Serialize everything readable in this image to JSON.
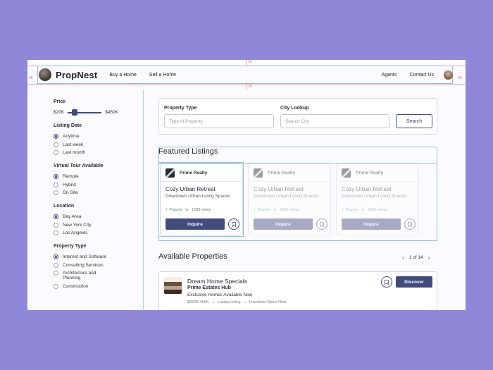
{
  "guides": {
    "top_gap": "16",
    "side_gap_left": "40",
    "side_gap_right": "40",
    "below_header_gap": "16"
  },
  "header": {
    "brand": "PropNest",
    "nav_left": [
      "Buy a Home",
      "Sell a Home"
    ],
    "nav_right": [
      "Agents",
      "Contact Us"
    ]
  },
  "filters": {
    "price": {
      "title": "Price",
      "min_label": "$20K",
      "max_label": "$450K",
      "level_fraction": 0.15
    },
    "listing_date": {
      "title": "Listing Date",
      "options": [
        "Anytime",
        "Last week",
        "Last month"
      ],
      "selected": 0
    },
    "virtual_tour": {
      "title": "Virtual Tour Available",
      "options": [
        "Remote",
        "Hybrid",
        "On Site"
      ],
      "selected": 0
    },
    "location": {
      "title": "Location",
      "options": [
        "Bay Area",
        "New York City",
        "Los Angeles"
      ],
      "selected": 0
    },
    "property_type": {
      "title": "Property Type",
      "options": [
        "Internet and Software",
        "Consulting Services",
        "Architecture and Planning",
        "Construction"
      ],
      "selected": 0
    }
  },
  "search": {
    "property_type_label": "Property Type",
    "property_type_placeholder": "Type of Property",
    "city_label": "City Lookup",
    "city_placeholder": "Search City",
    "button": "Search"
  },
  "featured": {
    "title": "Featured Listings",
    "cards": [
      {
        "company": "Prime Realty",
        "title": "Cozy Urban Retreat",
        "subtitle": "Downtown Urban Living Spaces",
        "badge": "Popular",
        "views": "1500 views",
        "button": "Inquire"
      },
      {
        "company": "Prime Realty",
        "title": "Cozy Urban Retreat",
        "subtitle": "Downtown Urban Living Spaces",
        "badge": "Popular",
        "views": "1500 views",
        "button": "Inquire"
      },
      {
        "company": "Prime Realty",
        "title": "Cozy Urban Retreat",
        "subtitle": "Downtown Urban Living Spaces",
        "badge": "Popular",
        "views": "1500 views",
        "button": "Inquire"
      }
    ]
  },
  "available": {
    "title": "Available Properties",
    "pager": "1 of 14",
    "listing": {
      "title": "Dream Home Specials",
      "company": "Prime Estates Hub",
      "tagline": "Exclusive Homes Available Now",
      "meta": [
        "$250K-450K",
        "Luxury Living",
        "Luxurious Open Floor"
      ],
      "button": "Discover"
    }
  },
  "colors": {
    "accent": "#414c7d",
    "background": "#8f88d8",
    "popular": "#3aa86b"
  },
  "icons": [
    "logo-icon",
    "avatar-icon",
    "bookmark-icon",
    "arrow-up-icon",
    "chevron-left-icon",
    "chevron-right-icon"
  ]
}
